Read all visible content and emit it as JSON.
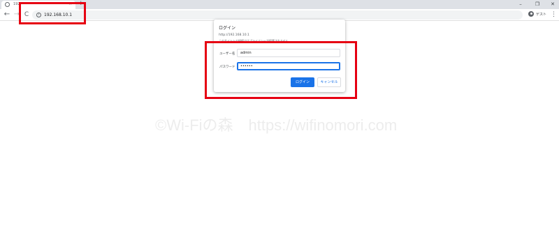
{
  "browser": {
    "tab": {
      "title": "192",
      "close": "×",
      "favicon": "globe-icon"
    },
    "new_tab": "+",
    "window": {
      "minimize": "–",
      "maximize": "❐",
      "close": "✕"
    },
    "nav": {
      "back": "←",
      "forward": "→",
      "reload": "C"
    },
    "address": {
      "info": "i",
      "url": "192.168.10.1"
    },
    "profile": {
      "label": "ゲスト"
    },
    "menu": "⋮"
  },
  "dialog": {
    "title": "ログイン",
    "origin": "http://192.168.10.1",
    "note": "このサイトへの接続ではプライバシーが保護されません",
    "username_label": "ユーザー名",
    "username_value": "admin",
    "password_label": "パスワード",
    "password_value": "••••••",
    "login_button": "ログイン",
    "cancel_button": "キャンセル"
  },
  "watermark": "©Wi-Fiの森　https://wifinomori.com",
  "colors": {
    "accent": "#1a73e8",
    "highlight": "#e60012"
  }
}
